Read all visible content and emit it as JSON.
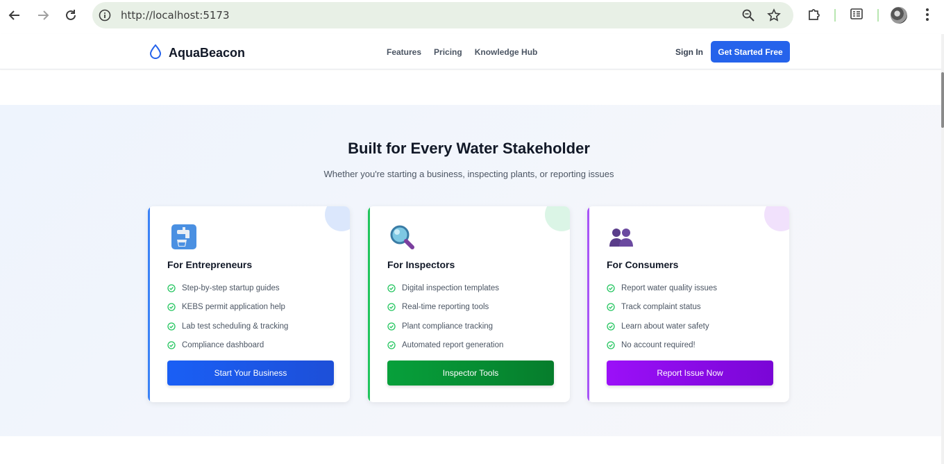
{
  "browser": {
    "url": "http://localhost:5173"
  },
  "header": {
    "brand": "AquaBeacon",
    "nav": [
      "Features",
      "Pricing",
      "Knowledge Hub"
    ],
    "sign_in": "Sign In",
    "cta": "Get Started Free"
  },
  "section": {
    "title": "Built for Every Water Stakeholder",
    "subtitle": "Whether you're starting a business, inspecting plants, or reporting issues"
  },
  "cards": [
    {
      "title": "For Entrepreneurs",
      "icon": "water-tap-icon",
      "accent": "#3b82f6",
      "items": [
        "Step-by-step startup guides",
        "KEBS permit application help",
        "Lab test scheduling & tracking",
        "Compliance dashboard"
      ],
      "button": "Start Your Business",
      "button_color": "#1d5cf0"
    },
    {
      "title": "For Inspectors",
      "icon": "magnifying-glass-icon",
      "accent": "#22c55e",
      "items": [
        "Digital inspection templates",
        "Real-time reporting tools",
        "Plant compliance tracking",
        "Automated report generation"
      ],
      "button": "Inspector Tools",
      "button_color": "#059133"
    },
    {
      "title": "For Consumers",
      "icon": "people-icon",
      "accent": "#a855f7",
      "items": [
        "Report water quality issues",
        "Track complaint status",
        "Learn about water safety",
        "No account required!"
      ],
      "button": "Report Issue Now",
      "button_color": "#8b0ff0"
    }
  ]
}
